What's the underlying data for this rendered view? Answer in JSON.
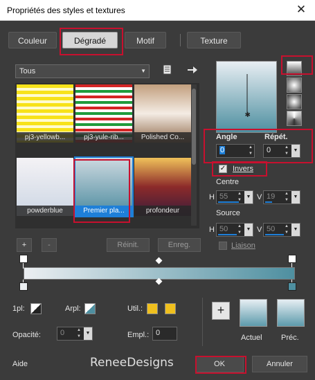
{
  "window": {
    "title": "Propriétés des styles et textures",
    "close": "✕"
  },
  "tabs": [
    {
      "label": "Couleur"
    },
    {
      "label": "Dégradé"
    },
    {
      "label": "Motif"
    },
    {
      "label": "Texture"
    }
  ],
  "active_tab": "Dégradé",
  "category": {
    "value": "Tous"
  },
  "gradients": [
    {
      "label": "pj3-yellowb...",
      "colors": [
        "#f7e21a",
        "#fffbd0"
      ]
    },
    {
      "label": "pj3-yule-rib...",
      "colors": [
        "#d42525",
        "#ffffff",
        "#1f9c3c"
      ]
    },
    {
      "label": "Polished Co...",
      "colors": [
        "#c29f7e",
        "#f4ece4",
        "#8f6a4b"
      ]
    },
    {
      "label": "powderblue",
      "colors": [
        "#f4f2f5",
        "#ccd6e4"
      ]
    },
    {
      "label": "Premier pla...",
      "colors": [
        "#cdd9e0",
        "#4b8a9e"
      ],
      "selected": true
    },
    {
      "label": "profondeur",
      "colors": [
        "#f0c25a",
        "#8c2a2a",
        "#3a1d3a"
      ]
    }
  ],
  "list_buttons": {
    "add": "+",
    "remove": "-",
    "reset": "Réinit.",
    "save": "Enreg."
  },
  "angle": {
    "label": "Angle",
    "value": "0"
  },
  "repeat": {
    "label": "Répét.",
    "value": "0"
  },
  "invert": {
    "label": "Invers",
    "checked": true
  },
  "center": {
    "label": "Centre",
    "h_label": "H",
    "h_value": "55",
    "v_label": "V",
    "v_value": "19"
  },
  "source": {
    "label": "Source",
    "h_label": "H",
    "h_value": "50",
    "v_label": "V",
    "v_value": "50"
  },
  "link": {
    "label": "Liaison"
  },
  "stop_controls": {
    "opacity_label": "1pl:",
    "bgcolor_label": "Arpl:",
    "util_label": "Util.:",
    "opacite_label": "Opacité:",
    "opacite_value": "0",
    "empl_label": "Empl.:",
    "empl_value": "0",
    "util_color": "#f0c01e"
  },
  "plus_button": "+",
  "current": {
    "label": "Actuel"
  },
  "previous": {
    "label": "Préc."
  },
  "help": "Aide",
  "watermark": "ReneeDesigns",
  "ok": "OK",
  "cancel": "Annuler",
  "colors": {
    "accent": "#1e7fd8",
    "highlight": "#c8102e",
    "panel": "#3b3b3b"
  }
}
